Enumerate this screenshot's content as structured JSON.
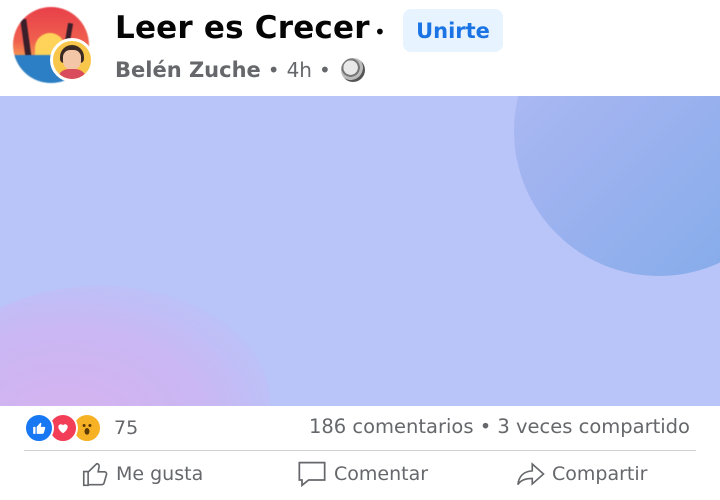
{
  "post": {
    "group_name": "Leer es Crecer",
    "separator": "•",
    "join_label": "Unirte",
    "author": "Belén Zuche",
    "meta_dot": "•",
    "time": "4h",
    "privacy_dot": "•",
    "privacy_icon": "globe-icon"
  },
  "reactions": {
    "icons": [
      "like-icon",
      "love-icon",
      "wow-icon"
    ],
    "count": "75",
    "comments": "186 comentarios",
    "stats_dot": "•",
    "shares": "3 veces compartido"
  },
  "actions": {
    "like_label": "Me gusta",
    "comment_label": "Comentar",
    "share_label": "Compartir"
  },
  "colors": {
    "accent": "#1b74e4",
    "media_bg": "#b9c4f8",
    "text_secondary": "#65676b"
  }
}
